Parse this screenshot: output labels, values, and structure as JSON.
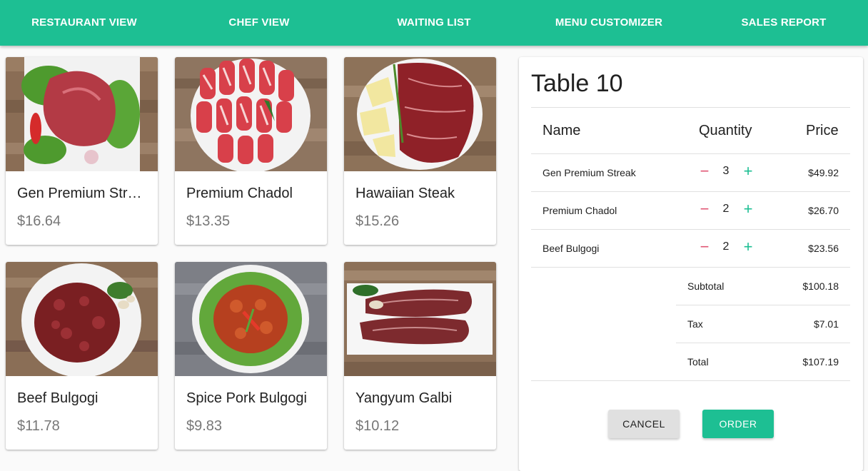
{
  "nav": {
    "items": [
      {
        "label": "RESTAURANT VIEW"
      },
      {
        "label": "CHEF VIEW"
      },
      {
        "label": "WAITING LIST"
      },
      {
        "label": "MENU CUSTOMIZER"
      },
      {
        "label": "SALES REPORT"
      }
    ]
  },
  "menu": {
    "items": [
      {
        "name": "Gen Premium Streak",
        "price": "$16.64"
      },
      {
        "name": "Premium Chadol",
        "price": "$13.35"
      },
      {
        "name": "Hawaiian Steak",
        "price": "$15.26"
      },
      {
        "name": "Beef Bulgogi",
        "price": "$11.78"
      },
      {
        "name": "Spice Pork Bulgogi",
        "price": "$9.83"
      },
      {
        "name": "Yangyum Galbi",
        "price": "$10.12"
      }
    ]
  },
  "order": {
    "title": "Table 10",
    "headers": {
      "name": "Name",
      "quantity": "Quantity",
      "price": "Price"
    },
    "lines": [
      {
        "name": "Gen Premium Streak",
        "qty": "3",
        "price": "$49.92"
      },
      {
        "name": "Premium Chadol",
        "qty": "2",
        "price": "$26.70"
      },
      {
        "name": "Beef Bulgogi",
        "qty": "2",
        "price": "$23.56"
      }
    ],
    "subtotal_label": "Subtotal",
    "subtotal": "$100.18",
    "tax_label": "Tax",
    "tax": "$7.01",
    "total_label": "Total",
    "total": "$107.19",
    "minus_symbol": "−",
    "plus_symbol": "+",
    "cancel_label": "CANCEL",
    "order_label": "ORDER"
  }
}
